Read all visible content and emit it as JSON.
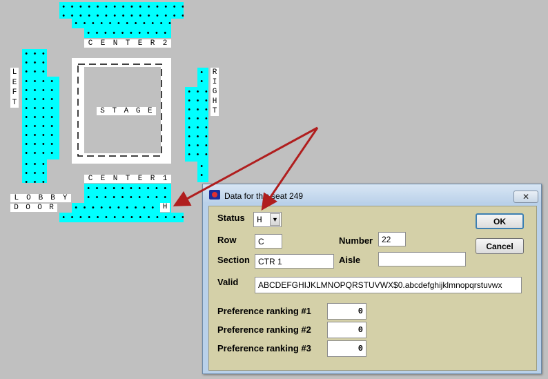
{
  "seat_map": {
    "labels": {
      "center2": "CENTER2",
      "center1": "CENTER1",
      "left": "LEFT",
      "right": "RIGHT",
      "stage": "STAGE",
      "lobby": "LOBBY",
      "door": "DOOR",
      "seat_marker": "H"
    },
    "seat_color": "#00ffff",
    "background_color": "#c0c0c0"
  },
  "dialog": {
    "title": "Data for this seat  249",
    "close_glyph": "✕",
    "status_label": "Status",
    "status_value": "H",
    "row_label": "Row",
    "row_value": "C",
    "number_label": "Number",
    "number_value": "22",
    "section_label": "Section",
    "section_value": "CTR 1",
    "aisle_label": "Aisle",
    "aisle_value": "",
    "valid_label": "Valid",
    "valid_value": "ABCDEFGHIJKLMNOPQRSTUVWX$0.abcdefghijklmnopqrstuvwx",
    "pref1_label": "Preference ranking #1",
    "pref1_value": "0",
    "pref2_label": "Preference ranking #2",
    "pref2_value": "0",
    "pref3_label": "Preference ranking #3",
    "pref3_value": "0",
    "ok_label": "OK",
    "cancel_label": "Cancel"
  },
  "annotation_color": "#b01e1e"
}
